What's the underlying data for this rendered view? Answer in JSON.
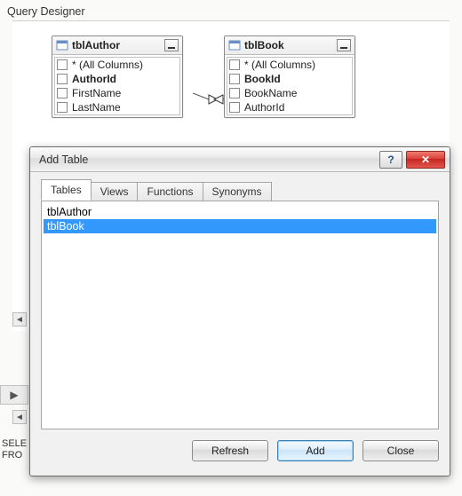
{
  "designer": {
    "title": "Query Designer",
    "tables": [
      {
        "name": "tblAuthor",
        "columns": [
          {
            "label": "* (All Columns)",
            "bold": false
          },
          {
            "label": "AuthorId",
            "bold": true
          },
          {
            "label": "FirstName",
            "bold": false
          },
          {
            "label": "LastName",
            "bold": false
          }
        ]
      },
      {
        "name": "tblBook",
        "columns": [
          {
            "label": "* (All Columns)",
            "bold": false
          },
          {
            "label": "BookId",
            "bold": true
          },
          {
            "label": "BookName",
            "bold": false
          },
          {
            "label": "AuthorId",
            "bold": false
          }
        ]
      }
    ],
    "sql_preview": "SELE\nFRO"
  },
  "dialog": {
    "title": "Add Table",
    "help_symbol": "?",
    "close_symbol": "✕",
    "tabs": [
      "Tables",
      "Views",
      "Functions",
      "Synonyms"
    ],
    "active_tab": 0,
    "items": [
      "tblAuthor",
      "tblBook"
    ],
    "selected_index": 1,
    "buttons": {
      "refresh": "Refresh",
      "add": "Add",
      "close": "Close"
    }
  }
}
